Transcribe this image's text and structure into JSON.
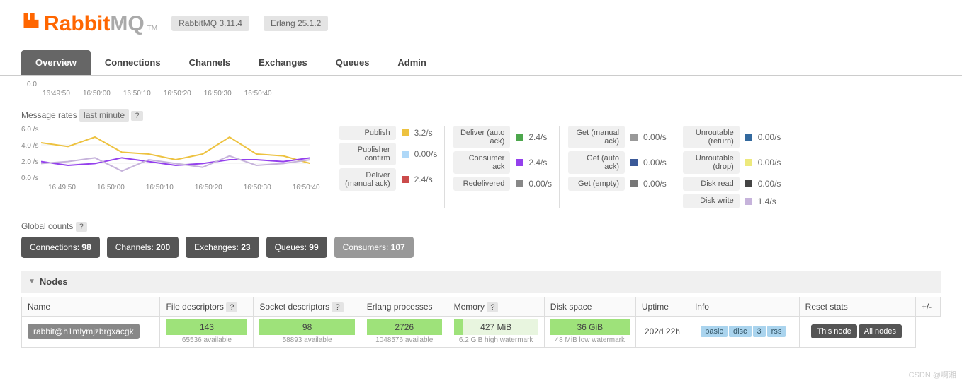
{
  "header": {
    "logo_rabbit": "Rabbit",
    "logo_mq": "MQ",
    "tm": "TM",
    "version_badge": "RabbitMQ 3.11.4",
    "erlang_badge": "Erlang 25.1.2"
  },
  "tabs": [
    "Overview",
    "Connections",
    "Channels",
    "Exchanges",
    "Queues",
    "Admin"
  ],
  "top_chart": {
    "xticks": [
      "16:49:50",
      "16:50:00",
      "16:50:10",
      "16:50:20",
      "16:50:30",
      "16:50:40"
    ],
    "y0": "0.0"
  },
  "message_rates": {
    "title": "Message rates",
    "range": "last minute",
    "help": "?"
  },
  "chart_data": {
    "type": "line",
    "title": "Message rates",
    "xlabel": "",
    "ylabel": "",
    "ylim": [
      0,
      6
    ],
    "yticks": [
      "0.0 /s",
      "2.0 /s",
      "4.0 /s",
      "6.0 /s"
    ],
    "categories": [
      "16:49:50",
      "16:50:00",
      "16:50:10",
      "16:50:20",
      "16:50:30",
      "16:50:40"
    ],
    "series": [
      {
        "name": "Publish",
        "color": "#edc240",
        "values": [
          4.2,
          3.8,
          4.8,
          3.2,
          3.0,
          2.4,
          3.0,
          4.8,
          3.0,
          2.8,
          2.0
        ]
      },
      {
        "name": "Deliver (manual ack)",
        "color": "#9440ed",
        "values": [
          2.2,
          1.8,
          2.0,
          2.6,
          2.2,
          1.8,
          2.0,
          2.4,
          2.4,
          2.2,
          2.6
        ]
      },
      {
        "name": "Deliver (auto ack)",
        "color": "#c6b3db",
        "values": [
          2.0,
          2.2,
          2.6,
          1.2,
          2.4,
          2.0,
          1.6,
          2.8,
          1.8,
          2.0,
          2.4
        ]
      }
    ]
  },
  "metrics": {
    "col1": [
      {
        "label": "Publish",
        "color": "#edc240",
        "value": "3.2/s"
      },
      {
        "label": "Publisher confirm",
        "color": "#afd8f8",
        "value": "0.00/s"
      },
      {
        "label": "Deliver (manual ack)",
        "color": "#cb4b4b",
        "value": "2.4/s"
      }
    ],
    "col2": [
      {
        "label": "Deliver (auto ack)",
        "color": "#4da74d",
        "value": "2.4/s"
      },
      {
        "label": "Consumer ack",
        "color": "#9440ed",
        "value": "2.4/s"
      },
      {
        "label": "Redelivered",
        "color": "#888888",
        "value": "0.00/s"
      }
    ],
    "col3": [
      {
        "label": "Get (manual ack)",
        "color": "#999999",
        "value": "0.00/s"
      },
      {
        "label": "Get (auto ack)",
        "color": "#3b5998",
        "value": "0.00/s"
      },
      {
        "label": "Get (empty)",
        "color": "#777777",
        "value": "0.00/s"
      }
    ],
    "col4": [
      {
        "label": "Unroutable (return)",
        "color": "#33699e",
        "value": "0.00/s"
      },
      {
        "label": "Unroutable (drop)",
        "color": "#ede97c",
        "value": "0.00/s"
      },
      {
        "label": "Disk read",
        "color": "#444444",
        "value": "0.00/s"
      },
      {
        "label": "Disk write",
        "color": "#c6b3db",
        "value": "1.4/s"
      }
    ]
  },
  "global_counts": {
    "title": "Global counts",
    "help": "?",
    "items": [
      {
        "label": "Connections:",
        "value": "98"
      },
      {
        "label": "Channels:",
        "value": "200"
      },
      {
        "label": "Exchanges:",
        "value": "23"
      },
      {
        "label": "Queues:",
        "value": "99"
      },
      {
        "label": "Consumers:",
        "value": "107"
      }
    ]
  },
  "nodes": {
    "title": "Nodes",
    "columns": [
      "Name",
      "File descriptors",
      "Socket descriptors",
      "Erlang processes",
      "Memory",
      "Disk space",
      "Uptime",
      "Info",
      "Reset stats",
      "+/-"
    ],
    "help": "?",
    "row": {
      "name": "rabbit@h1mlymjzbrgxacgk",
      "fd": "143",
      "fd_sub": "65536 available",
      "sd": "98",
      "sd_sub": "58893 available",
      "ep": "2726",
      "ep_sub": "1048576 available",
      "mem": "427 MiB",
      "mem_sub": "6.2 GiB high watermark",
      "disk": "36 GiB",
      "disk_sub": "48 MiB low watermark",
      "uptime": "202d 22h",
      "info": [
        "basic",
        "disc",
        "3",
        "rss"
      ],
      "reset": [
        "This node",
        "All nodes"
      ]
    }
  },
  "watermark": "CSDN @啊湘"
}
